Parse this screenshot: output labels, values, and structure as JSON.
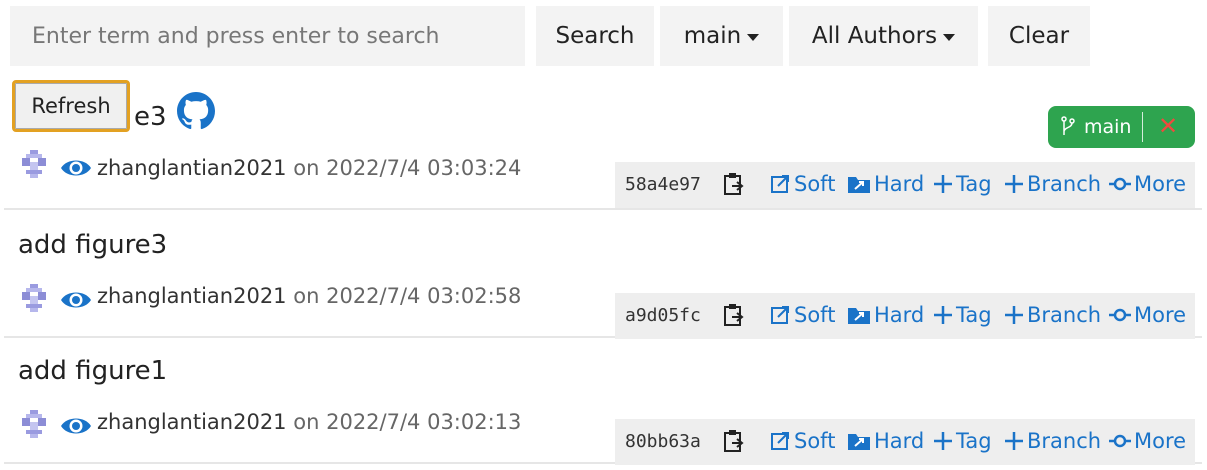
{
  "toolbar": {
    "search_placeholder": "Enter term and press enter to search",
    "search_label": "Search",
    "branch_label": "main",
    "authors_label": "All Authors",
    "clear_label": "Clear"
  },
  "refresh_label": "Refresh",
  "first_title_visible": "e3",
  "current_branch": {
    "label": "main",
    "color": "#2ea44f"
  },
  "commits": [
    {
      "title": "add figure3",
      "author": "zhanglantian2021",
      "on": "on",
      "date": "2022/7/4 03:03:24",
      "hash": "58a4e97"
    },
    {
      "title": "add figure3",
      "author": "zhanglantian2021",
      "on": "on",
      "date": "2022/7/4 03:02:58",
      "hash": "a9d05fc"
    },
    {
      "title": "add figure1",
      "author": "zhanglantian2021",
      "on": "on",
      "date": "2022/7/4 03:02:13",
      "hash": "80bb63a"
    }
  ],
  "actions": {
    "soft": "Soft",
    "hard": "Hard",
    "tag": "Tag",
    "branch": "Branch",
    "more": "More"
  },
  "colors": {
    "link": "#1a73c8",
    "accent_orange": "#e3a122"
  }
}
